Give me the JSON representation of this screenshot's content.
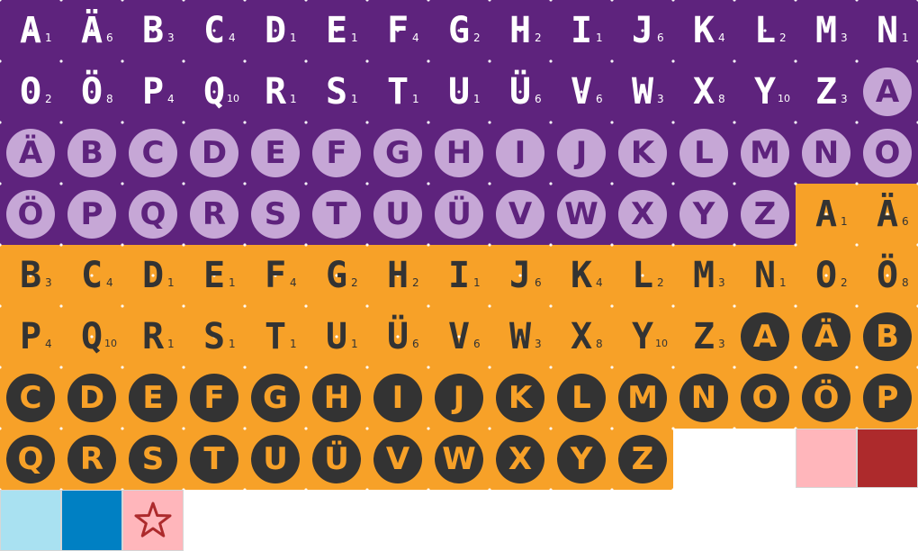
{
  "colors": {
    "purple_bg": "#5E237D",
    "purple_circle": "#C6A7D6",
    "purple_circle_text": "#5E237D",
    "orange_bg": "#F7A128",
    "dark_circle": "#333333",
    "dark_text": "#333333",
    "white": "#ffffff"
  },
  "sets": [
    {
      "id": "purple-tiles",
      "style": "tile",
      "bg": "#5E237D",
      "fg": "#ffffff",
      "tiles": [
        {
          "l": "A",
          "p": "1"
        },
        {
          "l": "Ä",
          "p": "6"
        },
        {
          "l": "B",
          "p": "3"
        },
        {
          "l": "C",
          "p": "4"
        },
        {
          "l": "D",
          "p": "1"
        },
        {
          "l": "E",
          "p": "1"
        },
        {
          "l": "F",
          "p": "4"
        },
        {
          "l": "G",
          "p": "2"
        },
        {
          "l": "H",
          "p": "2"
        },
        {
          "l": "I",
          "p": "1"
        },
        {
          "l": "J",
          "p": "6"
        },
        {
          "l": "K",
          "p": "4"
        },
        {
          "l": "L",
          "p": "2"
        },
        {
          "l": "M",
          "p": "3"
        },
        {
          "l": "N",
          "p": "1"
        },
        {
          "l": "O",
          "p": "2"
        },
        {
          "l": "Ö",
          "p": "8"
        },
        {
          "l": "P",
          "p": "4"
        },
        {
          "l": "Q",
          "p": "10"
        },
        {
          "l": "R",
          "p": "1"
        },
        {
          "l": "S",
          "p": "1"
        },
        {
          "l": "T",
          "p": "1"
        },
        {
          "l": "U",
          "p": "1"
        },
        {
          "l": "Ü",
          "p": "6"
        },
        {
          "l": "V",
          "p": "6"
        },
        {
          "l": "W",
          "p": "3"
        },
        {
          "l": "X",
          "p": "8"
        },
        {
          "l": "Y",
          "p": "10"
        },
        {
          "l": "Z",
          "p": "3"
        }
      ]
    },
    {
      "id": "purple-circles",
      "style": "circle",
      "bg": "#5E237D",
      "circle": "#C6A7D6",
      "fg": "#5E237D",
      "tiles": [
        {
          "l": "A"
        },
        {
          "l": "Ä"
        },
        {
          "l": "B"
        },
        {
          "l": "C"
        },
        {
          "l": "D"
        },
        {
          "l": "E"
        },
        {
          "l": "F"
        },
        {
          "l": "G"
        },
        {
          "l": "H"
        },
        {
          "l": "I"
        },
        {
          "l": "J"
        },
        {
          "l": "K"
        },
        {
          "l": "L"
        },
        {
          "l": "M"
        },
        {
          "l": "N"
        },
        {
          "l": "O"
        },
        {
          "l": "Ö"
        },
        {
          "l": "P"
        },
        {
          "l": "Q"
        },
        {
          "l": "R"
        },
        {
          "l": "S"
        },
        {
          "l": "T"
        },
        {
          "l": "U"
        },
        {
          "l": "Ü"
        },
        {
          "l": "V"
        },
        {
          "l": "W"
        },
        {
          "l": "X"
        },
        {
          "l": "Y"
        },
        {
          "l": "Z"
        }
      ]
    },
    {
      "id": "orange-tiles",
      "style": "tile",
      "bg": "#F7A128",
      "fg": "#333333",
      "tiles": [
        {
          "l": "A",
          "p": "1"
        },
        {
          "l": "Ä",
          "p": "6"
        },
        {
          "l": "B",
          "p": "3"
        },
        {
          "l": "C",
          "p": "4"
        },
        {
          "l": "D",
          "p": "1"
        },
        {
          "l": "E",
          "p": "1"
        },
        {
          "l": "F",
          "p": "4"
        },
        {
          "l": "G",
          "p": "2"
        },
        {
          "l": "H",
          "p": "2"
        },
        {
          "l": "I",
          "p": "1"
        },
        {
          "l": "J",
          "p": "6"
        },
        {
          "l": "K",
          "p": "4"
        },
        {
          "l": "L",
          "p": "2"
        },
        {
          "l": "M",
          "p": "3"
        },
        {
          "l": "N",
          "p": "1"
        },
        {
          "l": "O",
          "p": "2"
        },
        {
          "l": "Ö",
          "p": "8"
        },
        {
          "l": "P",
          "p": "4"
        },
        {
          "l": "Q",
          "p": "10"
        },
        {
          "l": "R",
          "p": "1"
        },
        {
          "l": "S",
          "p": "1"
        },
        {
          "l": "T",
          "p": "1"
        },
        {
          "l": "U",
          "p": "1"
        },
        {
          "l": "Ü",
          "p": "6"
        },
        {
          "l": "V",
          "p": "6"
        },
        {
          "l": "W",
          "p": "3"
        },
        {
          "l": "X",
          "p": "8"
        },
        {
          "l": "Y",
          "p": "10"
        },
        {
          "l": "Z",
          "p": "3"
        }
      ]
    },
    {
      "id": "orange-circles",
      "style": "circle",
      "bg": "#F7A128",
      "circle": "#333333",
      "fg": "#F7A128",
      "tiles": [
        {
          "l": "A"
        },
        {
          "l": "Ä"
        },
        {
          "l": "B"
        },
        {
          "l": "C"
        },
        {
          "l": "D"
        },
        {
          "l": "E"
        },
        {
          "l": "F"
        },
        {
          "l": "G"
        },
        {
          "l": "H"
        },
        {
          "l": "I"
        },
        {
          "l": "J"
        },
        {
          "l": "K"
        },
        {
          "l": "L"
        },
        {
          "l": "M"
        },
        {
          "l": "N"
        },
        {
          "l": "O"
        },
        {
          "l": "Ö"
        },
        {
          "l": "P"
        },
        {
          "l": "Q"
        },
        {
          "l": "R"
        },
        {
          "l": "S"
        },
        {
          "l": "T"
        },
        {
          "l": "U"
        },
        {
          "l": "Ü"
        },
        {
          "l": "V"
        },
        {
          "l": "W"
        },
        {
          "l": "X"
        },
        {
          "l": "Y"
        },
        {
          "l": "Z"
        }
      ]
    }
  ],
  "swatches": [
    {
      "name": "pink",
      "color": "#FFB6BB"
    },
    {
      "name": "dark-red",
      "color": "#AD2A2C"
    },
    {
      "name": "light-blue",
      "color": "#A9E1F1"
    },
    {
      "name": "blue",
      "color": "#0080C3"
    },
    {
      "name": "pink-star",
      "color": "#FFB6BB",
      "icon": "star-icon",
      "icon_color": "#AD2A2C"
    }
  ]
}
